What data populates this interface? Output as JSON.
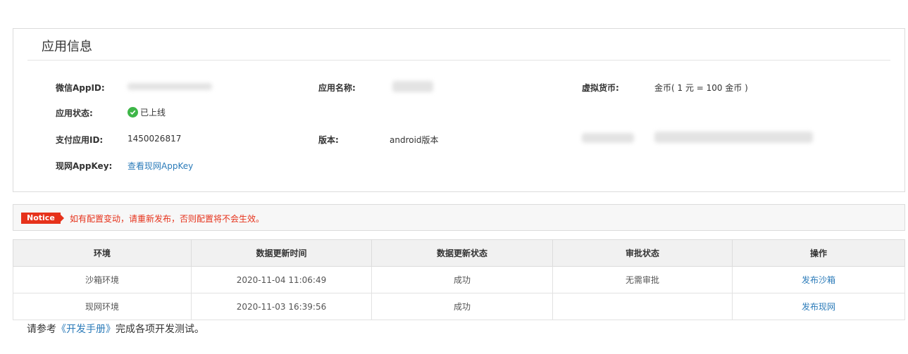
{
  "app_info": {
    "title": "应用信息",
    "wechat_appid_label": "微信AppID:",
    "app_name_label": "应用名称:",
    "virtual_currency_label": "虚拟货币:",
    "virtual_currency_value": "金币( 1 元 = 100 金币 )",
    "app_status_label": "应用状态:",
    "app_status_value": "已上线",
    "pay_appid_label": "支付应用ID:",
    "pay_appid_value": "1450026817",
    "version_label": "版本:",
    "version_value": "android版本",
    "live_appkey_label": "现网AppKey:",
    "live_appkey_link": "查看现网AppKey"
  },
  "notice": {
    "badge": "Notice",
    "text": "如有配置变动，请重新发布，否则配置将不会生效。"
  },
  "table": {
    "headers": [
      "环境",
      "数据更新时间",
      "数据更新状态",
      "审批状态",
      "操作"
    ],
    "rows": [
      {
        "env": "沙箱环境",
        "time": "2020-11-04 11:06:49",
        "status": "成功",
        "approval": "无需审批",
        "action": "发布沙箱"
      },
      {
        "env": "现网环境",
        "time": "2020-11-03 16:39:56",
        "status": "成功",
        "approval": "",
        "action": "发布现网"
      }
    ]
  },
  "footer": {
    "prefix": "请参考",
    "link": "《开发手册》",
    "suffix": "完成各项开发测试。"
  },
  "colors": {
    "accent_link": "#2b7bb9",
    "notice_red": "#e6321b",
    "status_green": "#3eb648"
  }
}
